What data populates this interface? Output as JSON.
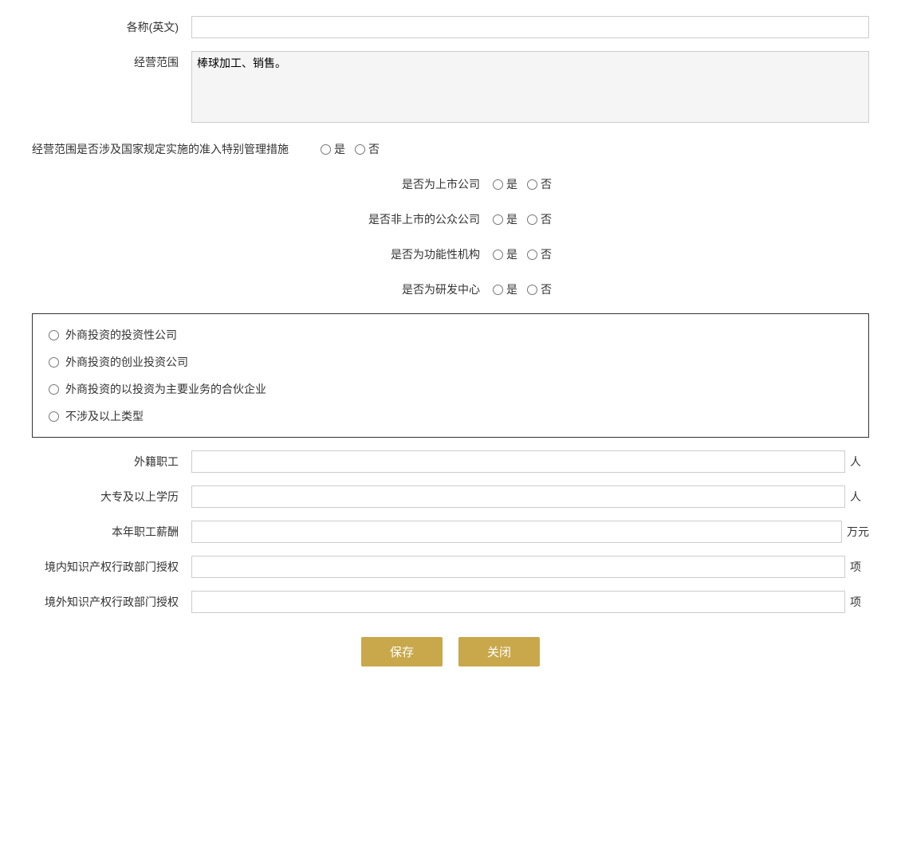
{
  "form": {
    "name_en_label": "各称(英文)",
    "name_en_placeholder": "",
    "business_scope_label": "经营范围",
    "business_scope_value": "棒球加工、销售。",
    "special_management_label": "经营范围是否涉及国家规定实施的准入特别管理措施",
    "yes_label": "是",
    "no_label": "否",
    "listed_company_label": "是否为上市公司",
    "non_listed_public_label": "是否非上市的公众公司",
    "functional_institution_label": "是否为功能性机构",
    "rd_center_label": "是否为研发中心",
    "investment_company_option": "外商投资的投资性公司",
    "venture_capital_option": "外商投资的创业投资公司",
    "partnership_option": "外商投资的以投资为主要业务的合伙企业",
    "not_applicable_option": "不涉及以上类型",
    "foreign_staff_label": "外籍职工",
    "foreign_staff_unit": "人",
    "education_label": "大专及以上学历",
    "education_unit": "人",
    "salary_label": "本年职工薪酬",
    "salary_unit": "万元",
    "domestic_ip_label": "境内知识产权行政部门授权",
    "domestic_ip_unit": "项",
    "foreign_ip_label": "境外知识产权行政部门授权",
    "foreign_ip_unit": "项",
    "save_button_label": "保存",
    "close_button_label": "关闭"
  }
}
